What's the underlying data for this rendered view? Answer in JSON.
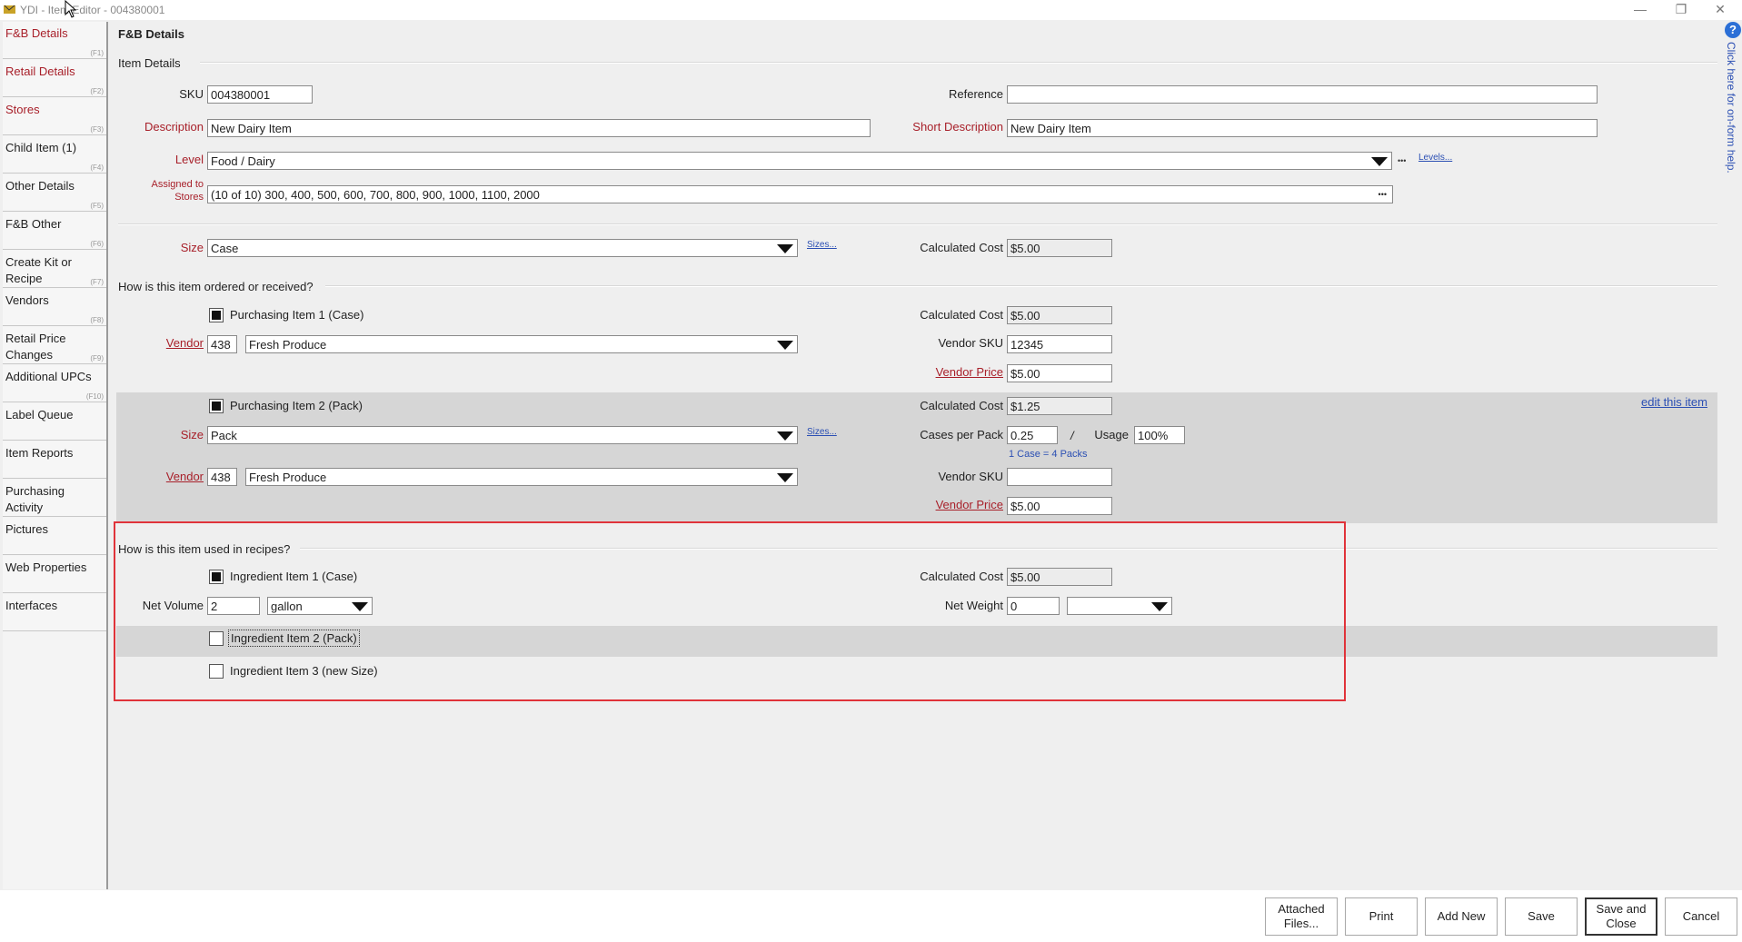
{
  "window": {
    "title": "YDI - Item Editor - 004380001",
    "minimize": "—",
    "restore": "❐",
    "close": "✕"
  },
  "sidebar": {
    "items": [
      {
        "label": "F&B Details",
        "key": "(F1)"
      },
      {
        "label": "Retail Details",
        "key": "(F2)"
      },
      {
        "label": "Stores",
        "key": "(F3)"
      },
      {
        "label": "Child Item (1)",
        "key": "(F4)"
      },
      {
        "label": "Other Details",
        "key": "(F5)"
      },
      {
        "label": "F&B Other",
        "key": "(F6)"
      },
      {
        "label": "Create Kit or Recipe",
        "key": "(F7)"
      },
      {
        "label": "Vendors",
        "key": "(F8)"
      },
      {
        "label": "Retail Price Changes",
        "key": "(F9)"
      },
      {
        "label": "Additional UPCs",
        "key": "(F10)"
      },
      {
        "label": "Label Queue",
        "key": ""
      },
      {
        "label": "Item Reports",
        "key": ""
      },
      {
        "label": "Purchasing Activity",
        "key": ""
      },
      {
        "label": "Pictures",
        "key": ""
      },
      {
        "label": "Web Properties",
        "key": ""
      },
      {
        "label": "Interfaces",
        "key": ""
      }
    ]
  },
  "header": {
    "page_title": "F&B Details",
    "section_title": "Item Details"
  },
  "item": {
    "sku_label": "SKU",
    "sku": "004380001",
    "reference_label": "Reference",
    "reference": "",
    "description_label": "Description",
    "description": "New Dairy Item",
    "short_description_label": "Short Description",
    "short_description": "New Dairy Item",
    "level_label": "Level",
    "level": "Food / Dairy",
    "levels_link": "Levels...",
    "assigned_label_1": "Assigned to",
    "assigned_label_2": "Stores",
    "assigned": "(10 of 10) 300, 400, 500, 600, 700, 800, 900, 1000, 1100, 2000",
    "ellipsis": "•••",
    "size_label": "Size",
    "size": "Case",
    "sizes_link": "Sizes...",
    "calc_cost_label": "Calculated Cost",
    "calc_cost": "$5.00"
  },
  "ordering": {
    "question": "How is this item ordered or received?",
    "p1": {
      "checkbox_label": "Purchasing Item 1 (Case)",
      "checked": true,
      "vendor_label": "Vendor",
      "vendor_code": "438",
      "vendor_name": "Fresh Produce",
      "calc_cost_label": "Calculated Cost",
      "calc_cost": "$5.00",
      "vendor_sku_label": "Vendor SKU",
      "vendor_sku": "12345",
      "vendor_price_label": "Vendor Price",
      "vendor_price": "$5.00"
    },
    "p2": {
      "checkbox_label": "Purchasing Item 2 (Pack)",
      "checked": true,
      "size_label": "Size",
      "size": "Pack",
      "sizes_link": "Sizes...",
      "vendor_label": "Vendor",
      "vendor_code": "438",
      "vendor_name": "Fresh Produce",
      "calc_cost_label": "Calculated Cost",
      "calc_cost": "$1.25",
      "cases_per_pack_label": "Cases per Pack",
      "cases_per_pack": "0.25",
      "slash": "/",
      "usage_label": "Usage",
      "usage": "100%",
      "conversion_note": "1 Case = 4 Packs",
      "vendor_sku_label": "Vendor SKU",
      "vendor_sku": "",
      "vendor_price_label": "Vendor Price",
      "vendor_price": "$5.00",
      "edit_link": "edit this item"
    }
  },
  "recipes": {
    "question": "How is this item used in recipes?",
    "i1_label": "Ingredient Item 1 (Case)",
    "i1_checked": true,
    "calc_cost_label": "Calculated Cost",
    "calc_cost": "$5.00",
    "net_volume_label": "Net Volume",
    "net_volume": "2",
    "net_volume_unit": "gallon",
    "net_weight_label": "Net Weight",
    "net_weight": "0",
    "net_weight_unit": "",
    "i2_label": "Ingredient Item 2 (Pack)",
    "i2_checked": false,
    "i3_label": "Ingredient Item 3 (new Size)",
    "i3_checked": false
  },
  "footer": {
    "attached_files": "Attached\nFiles...",
    "print": "Print",
    "add_new": "Add New",
    "save": "Save",
    "save_close": "Save and\nClose",
    "cancel": "Cancel"
  },
  "help": {
    "text": "Click here for on-form help."
  },
  "colors": {
    "accent_red": "#a8202a",
    "highlight_box": "#e0333a",
    "link_blue": "#2b4fb3"
  }
}
